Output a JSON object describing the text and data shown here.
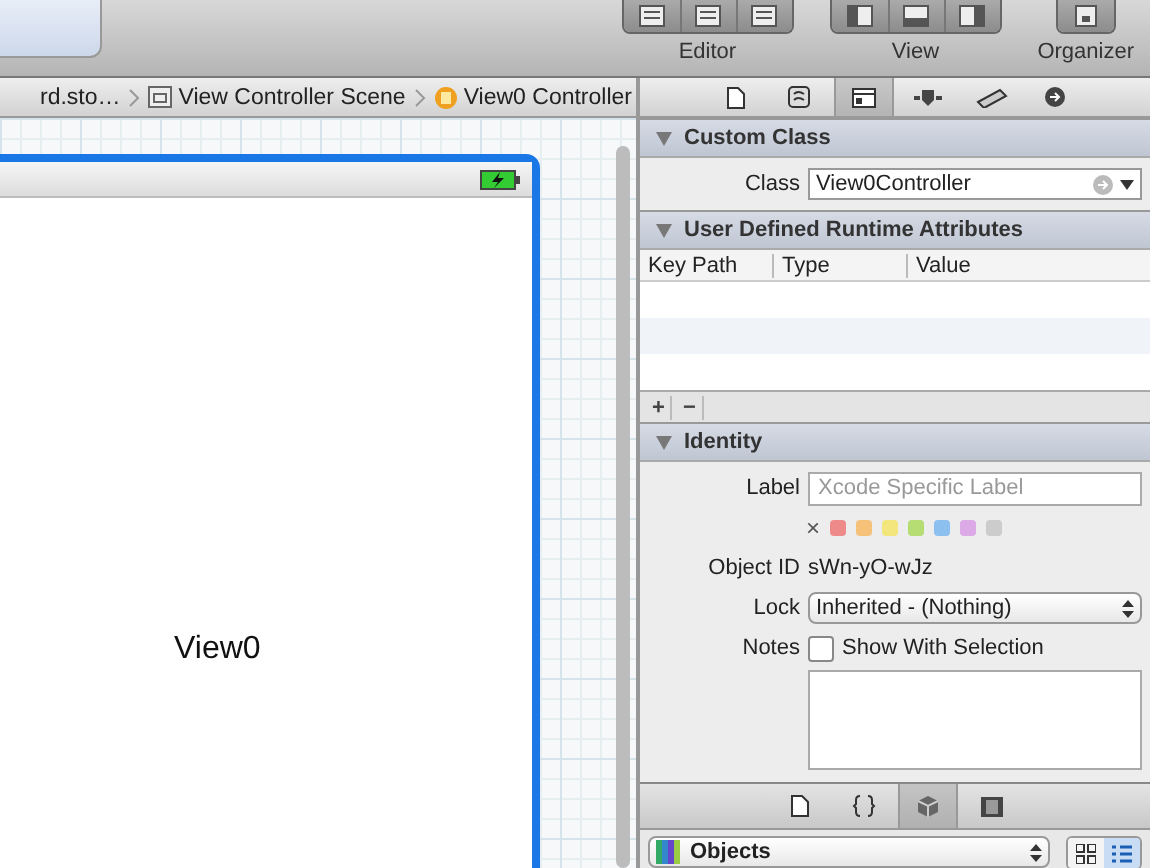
{
  "toolbar": {
    "groups": [
      {
        "label": "Editor",
        "kind": "editor"
      },
      {
        "label": "View",
        "kind": "view"
      },
      {
        "label": "Organizer",
        "kind": "organizer"
      }
    ]
  },
  "breadcrumb": [
    {
      "text": "rd.sto…",
      "kind": "file"
    },
    {
      "text": "View Controller Scene",
      "kind": "scene"
    },
    {
      "text": "View0 Controller",
      "kind": "controller"
    }
  ],
  "canvas": {
    "view_label": "View0"
  },
  "inspector_tabs": [
    {
      "kind": "file",
      "selected": false
    },
    {
      "kind": "help",
      "selected": false
    },
    {
      "kind": "identity",
      "selected": true
    },
    {
      "kind": "attributes",
      "selected": false
    },
    {
      "kind": "size",
      "selected": false
    },
    {
      "kind": "connections",
      "selected": false
    }
  ],
  "custom_class": {
    "title": "Custom Class",
    "expanded": true,
    "class_label": "Class",
    "class_value": "View0Controller"
  },
  "runtime_attributes": {
    "title": "User Defined Runtime Attributes",
    "expanded": true,
    "columns": [
      "Key Path",
      "Type",
      "Value"
    ],
    "buttons": [
      "+",
      "−"
    ]
  },
  "identity": {
    "title": "Identity",
    "expanded": true,
    "label_label": "Label",
    "label_placeholder": "Xcode Specific Label",
    "clear": "×",
    "colors": [
      {
        "color": "#ee8a8a"
      },
      {
        "color": "#f6c27a"
      },
      {
        "color": "#f2e67c"
      },
      {
        "color": "#b6dc74"
      },
      {
        "color": "#8cc0ee"
      },
      {
        "color": "#dcaae6"
      },
      {
        "color": "#cccccc"
      }
    ],
    "object_id_label": "Object ID",
    "object_id": "sWn-yO-wJz",
    "lock_label": "Lock",
    "lock_value": "Inherited - (Nothing)",
    "notes_label": "Notes",
    "notes_checkbox": {
      "label": "Show With Selection",
      "checked": false
    }
  },
  "library_tabs": [
    {
      "kind": "file",
      "selected": false
    },
    {
      "kind": "braces",
      "selected": false
    },
    {
      "kind": "cube",
      "selected": true
    },
    {
      "kind": "media",
      "selected": false
    }
  ],
  "library": {
    "popup": "Objects",
    "view_modes": [
      {
        "kind": "grid",
        "selected": false
      },
      {
        "kind": "list",
        "selected": true
      }
    ]
  }
}
